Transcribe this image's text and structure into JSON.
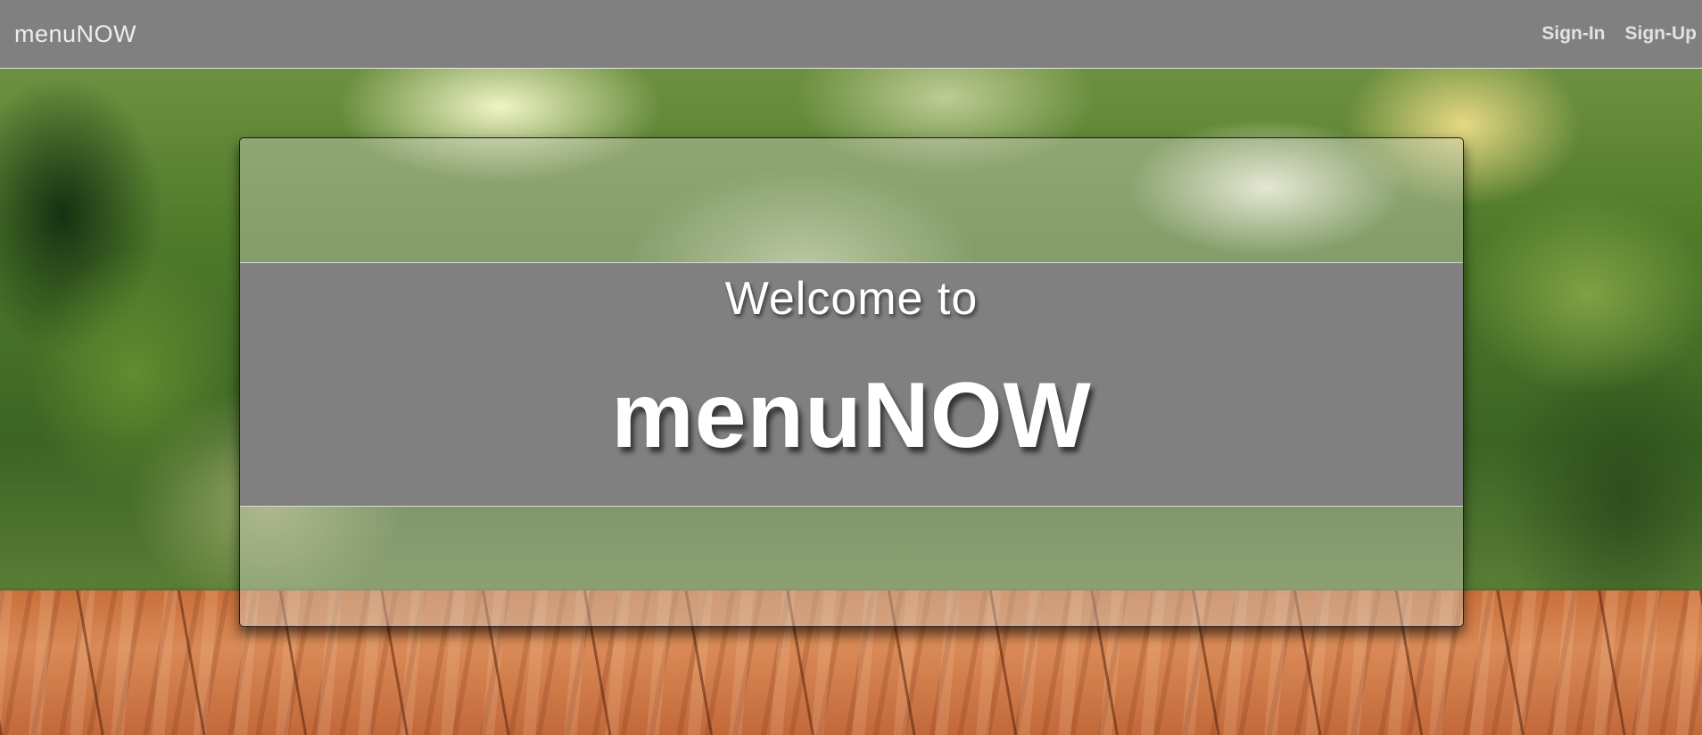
{
  "navbar": {
    "brand": "menuNOW",
    "links": [
      {
        "label": "Sign-In"
      },
      {
        "label": "Sign-Up"
      }
    ]
  },
  "hero": {
    "subtitle": "Welcome to",
    "title": "menuNOW"
  },
  "colors": {
    "navbar_bg": "#808080",
    "band_bg": "#808080",
    "text": "#ffffff"
  }
}
